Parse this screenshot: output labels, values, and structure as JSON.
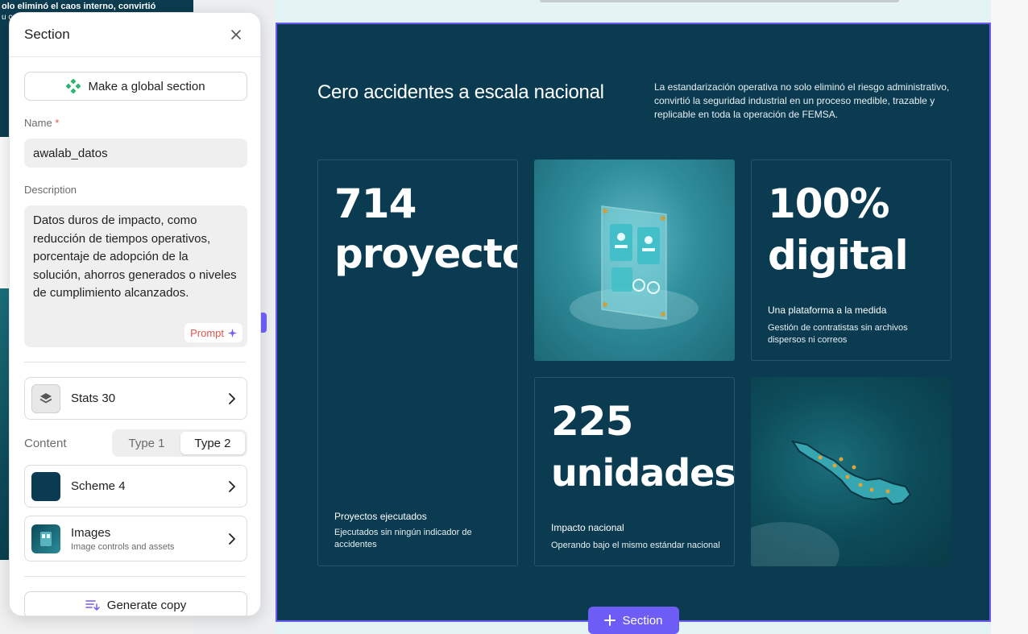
{
  "background_preview": {
    "line1": "olo eliminó el caos interno, convirtió",
    "line2": "u c"
  },
  "panel": {
    "title": "Section",
    "global_button": "Make a global section",
    "name_label": "Name",
    "name_required": "*",
    "name_value": "awalab_datos",
    "description_label": "Description",
    "description_value": "Datos duros de impacto, como reducción de tiempos operativos, porcentaje de adopción de la solución, ahorros generados o niveles de cumplimiento alcanzados.",
    "prompt_button": "Prompt",
    "layout_row": {
      "label": "Stats 30"
    },
    "content_label": "Content",
    "content_options": [
      "Type 1",
      "Type 2"
    ],
    "content_selected": "Type 2",
    "scheme_row": {
      "label": "Scheme 4",
      "swatch": "#0b3b51"
    },
    "images_row": {
      "label": "Images",
      "sub": "Image controls and assets"
    },
    "generate_button": "Generate copy"
  },
  "section": {
    "title": "Cero accidentes a escala nacional",
    "description": "La estandarización operativa no solo eliminó el riesgo administrativo, convirtió la seguridad industrial en un proceso medible, trazable y replicable en toda la operación de FEMSA.",
    "stats": [
      {
        "number": "714",
        "unit": "proyectos",
        "caption": "Proyectos ejecutados",
        "sub": "Ejecutados sin ningún indicador de accidentes"
      },
      {
        "number": "100%",
        "unit": "digital",
        "caption": "Una plataforma a la medida",
        "sub": "Gestión de contratistas sin archivos dispersos ni correos"
      },
      {
        "number": "225",
        "unit": "unidades",
        "caption": "Impacto nacional",
        "sub": "Operando bajo el mismo estándar nacional"
      }
    ]
  },
  "add_section_label": "Section",
  "colors": {
    "section_bg": "#0b3b51",
    "accent": "#6d5df6",
    "required": "#e35a5a",
    "prompt": "#e5534b"
  }
}
